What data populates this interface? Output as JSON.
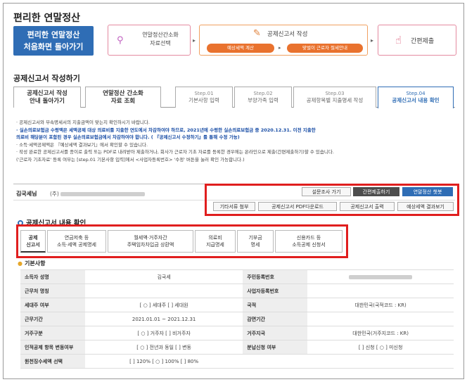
{
  "app": {
    "title": "편리한 연말정산"
  },
  "home_button": {
    "line1": "편리한 연말정산",
    "line2": "처음화면 돌아가기"
  },
  "steps": {
    "s1": {
      "line1": "연말정산간소화",
      "line2": "자료선택"
    },
    "s2": {
      "title": "공제신고서 작성",
      "pill1": "예상세액 계산",
      "pill2": "맞벌이 근로자 절세안내"
    },
    "s3": {
      "title": "간편제출"
    }
  },
  "section_title": "공제신고서 작성하기",
  "tabs": [
    {
      "line1": "공제신고서 작성",
      "line2": "안내 돌아가기"
    },
    {
      "line1": "연말정산 간소화",
      "line2": "자료 조회"
    },
    {
      "line1": "Step.01",
      "line2": "기본사항 입력"
    },
    {
      "line1": "Step.02",
      "line2": "부양가족 입력"
    },
    {
      "line1": "Step.03",
      "line2": "공제항목별 지출명세 작성"
    },
    {
      "line1": "Step.04",
      "line2": "공제신고서 내용 확인"
    }
  ],
  "notice": {
    "l1": "· 공제신고서와 부속명세서의 지출금액이 맞는지 확인하시기 바랍니다.",
    "l2": "· 실손의료보험금 수령액은 세액공제 대상 의료비를 지출한 연도에서 차감하여야 하므로, 2021년에 수령한 실손의료보험금 중 2020.12.31. 이전 지출한",
    "l3": "의료비 해당분이 포함된 경우 실손의료보험금에서 차감하여야 합니다. ( 『공제신고서 수정하기』를 통해 수정 가능)",
    "l4": "· 소득·세액공제액은 『예상세액 결과보기』에서 확인할 수 있습니다.",
    "l5": "· 작성 완료한 공제신고서를 종이로 출력 또는 PDF로 내려받아 제출하거나, 회사가 근로자 기초 자료를 등록한 경우에는 온라인으로 제출(간편제출하기)할 수 있습니다.",
    "l6": "('근로자 기초자료' 등록 여부는 [step.01 기본사항 입력]에서 <사업자등록번호> '수정' 버튼을 눌러 확인 가능합니다.)"
  },
  "user": {
    "name_label": "김국세님",
    "company_prefix": "(주)"
  },
  "toolbar": {
    "survey": "설문조사 가기",
    "quick_submit": "간편제출하기",
    "year_tax": "연말정산 챗봇",
    "attach_docs": "기타서류 첨부",
    "pdf_download": "공제신고서 PDF다운로드",
    "print": "공제신고서 출력",
    "expected_tax": "예상세액 결과보기"
  },
  "confirm_title": "공제신고서 내용 확인",
  "sub_tabs": [
    {
      "line1": "공제",
      "line2": "신고서"
    },
    {
      "line1": "연금저축 등",
      "line2": "소득·세액 공제명세"
    },
    {
      "line1": "월세액·거주자간",
      "line2": "주택임차차입금 상환액"
    },
    {
      "line1": "의료비",
      "line2": "지급명세"
    },
    {
      "line1": "기부금",
      "line2": "명세"
    },
    {
      "line1": "신용카드 등",
      "line2": "소득공제 신청서"
    }
  ],
  "basic_title": "기본사항",
  "info_rows": [
    {
      "h1": "소득자 성명",
      "v1": "김국세",
      "h2": "주민등록번호",
      "v2": ""
    },
    {
      "h1": "근무처 명칭",
      "v1": "",
      "h2": "사업자등록번호",
      "v2": ""
    },
    {
      "h1": "세대주 여부",
      "v1": "[ ○ ] 세대주  [    ] 세대원",
      "h2": "국적",
      "v2": "대한민국(국적코드 : KR)"
    },
    {
      "h1": "근무기간",
      "v1": "2021.01.01 ~ 2021.12.31",
      "h2": "감면기간",
      "v2": ""
    },
    {
      "h1": "거주구분",
      "v1": "[ ○ ] 거주자  [    ] 비거주자",
      "h2": "거주지국",
      "v2": "대한민국(거주지코드 : KR)"
    },
    {
      "h1": "인적공제 항목 변동여부",
      "v1": "[ ○ ] 전년과 동일  [    ] 변동",
      "h2": "분납신청 여부",
      "v2": "[    ] 신청  [ ○ ] 미신청"
    },
    {
      "h1": "원천징수세액 선택",
      "v1": "[    ] 120%  [ ○ ] 100%  [    ] 80%",
      "h2": "",
      "v2": ""
    }
  ]
}
